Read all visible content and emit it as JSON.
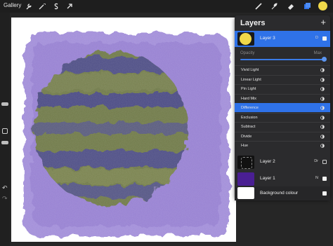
{
  "topbar": {
    "gallery_label": "Gallery",
    "left_tools": [
      "wrench-icon",
      "magic-wand-icon",
      "selection-s-icon",
      "transform-arrow-icon"
    ],
    "right_tools": [
      "brush-icon",
      "smudge-icon",
      "eraser-icon",
      "layers-icon",
      "color-swatch-icon"
    ],
    "current_color": "#f0d84a"
  },
  "leftbar": {
    "undo_glyph": "↶",
    "redo_glyph": "↷"
  },
  "layers_panel": {
    "title": "Layers",
    "add_glyph": "+",
    "selected_layer": {
      "name": "Layer 3",
      "mode": "D",
      "visible": true,
      "thumb_color": "#f0d84a"
    },
    "opacity_label": "Opacity",
    "opacity_max_label": "Max",
    "opacity_value": 1.0,
    "blend_modes": [
      {
        "label": "Vivid Light",
        "icon": "vivid-light-icon"
      },
      {
        "label": "Linear Light",
        "icon": "linear-light-icon"
      },
      {
        "label": "Pin Light",
        "icon": "pin-light-icon"
      },
      {
        "label": "Hard Mix",
        "icon": "hard-mix-icon"
      },
      {
        "label": "Difference",
        "icon": "difference-icon",
        "active": true
      },
      {
        "label": "Exclusion",
        "icon": "exclusion-icon"
      },
      {
        "label": "Subtract",
        "icon": "subtract-icon"
      },
      {
        "label": "Divide",
        "icon": "divide-icon"
      },
      {
        "label": "Hue",
        "icon": "hue-icon"
      }
    ],
    "other_layers": [
      {
        "name": "Layer 2",
        "mode": "Dr",
        "visible": false
      },
      {
        "name": "Layer 1",
        "mode": "N",
        "visible": true
      },
      {
        "name": "Background colour",
        "mode": "",
        "visible": true
      }
    ]
  },
  "colors": {
    "accent": "#2f72e8",
    "purple": "#9b84d6",
    "olive": "#6f7a4a"
  }
}
